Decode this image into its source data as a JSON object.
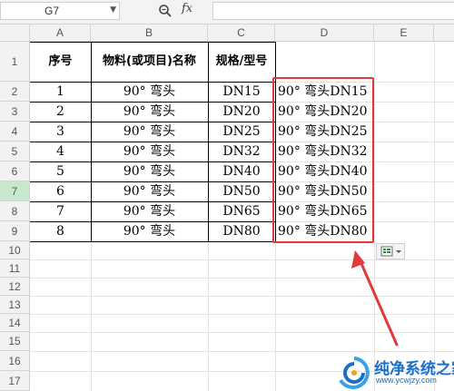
{
  "formula_bar": {
    "name_box": "G7",
    "fx_label": "fx",
    "formula_value": ""
  },
  "columns": [
    "A",
    "B",
    "C",
    "D",
    "E"
  ],
  "rows": [
    "1",
    "2",
    "3",
    "4",
    "5",
    "6",
    "7",
    "8",
    "9",
    "10",
    "11",
    "12",
    "13",
    "14",
    "15",
    "16",
    "17"
  ],
  "selected_row": "7",
  "sheet": {
    "headers": {
      "a": "序号",
      "b": "物料(或项目)名称",
      "c": "规格/型号",
      "d": ""
    },
    "data": [
      {
        "a": "1",
        "b": "90° 弯头",
        "c": "DN15",
        "d": "90° 弯头DN15"
      },
      {
        "a": "2",
        "b": "90° 弯头",
        "c": "DN20",
        "d": "90° 弯头DN20"
      },
      {
        "a": "3",
        "b": "90° 弯头",
        "c": "DN25",
        "d": "90° 弯头DN25"
      },
      {
        "a": "4",
        "b": "90° 弯头",
        "c": "DN32",
        "d": "90° 弯头DN32"
      },
      {
        "a": "5",
        "b": "90° 弯头",
        "c": "DN40",
        "d": "90° 弯头DN40"
      },
      {
        "a": "6",
        "b": "90° 弯头",
        "c": "DN50",
        "d": "90° 弯头DN50"
      },
      {
        "a": "7",
        "b": "90° 弯头",
        "c": "DN65",
        "d": "90° 弯头DN65"
      },
      {
        "a": "8",
        "b": "90° 弯头",
        "c": "DN80",
        "d": "90° 弯头DN80"
      }
    ]
  },
  "watermark": {
    "title": "纯净系统之家",
    "url": "www.ycwjzy.com"
  },
  "colors": {
    "highlight": "#e03a3a",
    "selected_row": "#c9e7cd",
    "watermark": "#1b6fc8"
  },
  "icons": [
    "zoom-icon",
    "fx-icon",
    "dropdown-arrow-icon",
    "paste-options-icon",
    "arrow-annotation-icon"
  ]
}
